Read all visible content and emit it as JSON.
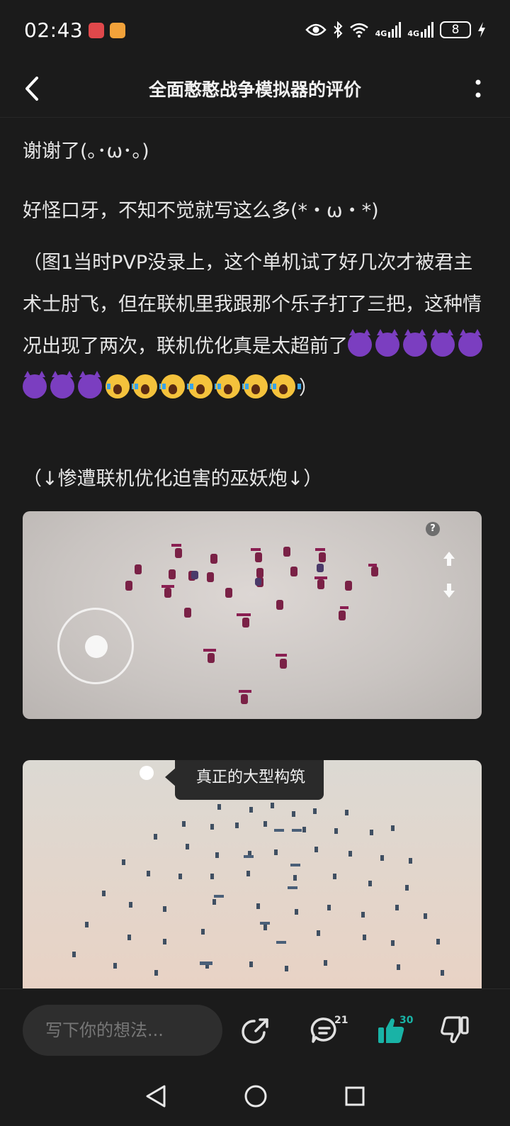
{
  "status_bar": {
    "time": "02:43",
    "network_1": "4G",
    "network_2": "4G",
    "battery": "8"
  },
  "header": {
    "title": "全面憨憨战争模拟器的评价"
  },
  "article": {
    "p1": "谢谢了(｡･ω･｡)",
    "p2": "好怪口牙，不知不觉就写这么多(*・ω・*)",
    "p3_text": "（图1当时PVP没录上，这个单机试了好几次才被君主术士肘飞，但在联机里我跟那个乐子打了三把，这种情况出现了两次，联机优化真是太超前了",
    "p3_end": "）",
    "p4": "（↓惨遭联机优化迫害的巫妖炮↓）"
  },
  "image1": {
    "help_glyph": "?"
  },
  "image2": {
    "tooltip": "真正的大型构筑"
  },
  "actions": {
    "comment_placeholder": "写下你的想法...",
    "comment_count": "21",
    "like_count": "30",
    "like_color": "#19b3a6"
  }
}
